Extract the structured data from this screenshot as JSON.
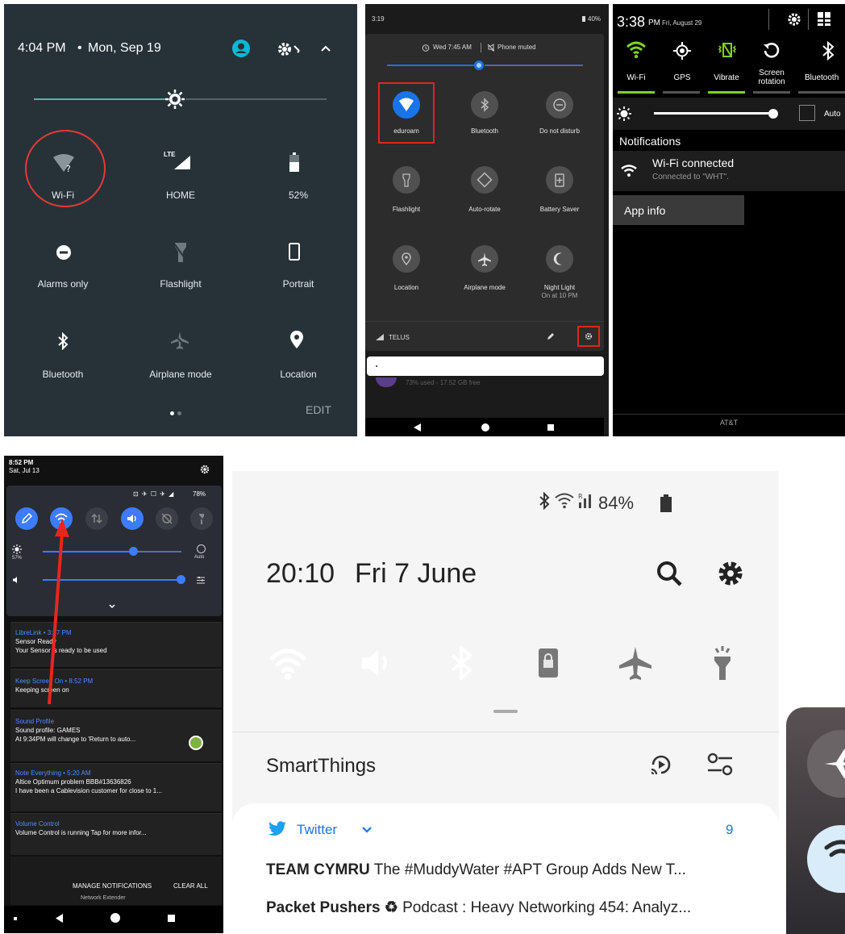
{
  "panel1": {
    "time": "4:04 PM",
    "sep": "•",
    "date": "Mon, Sep 19",
    "tiles": [
      {
        "label": "Wi-Fi",
        "icon": "wifi-unknown-icon"
      },
      {
        "label": "HOME",
        "icon": "lte-signal-icon"
      },
      {
        "label": "52%",
        "icon": "battery-icon"
      },
      {
        "label": "Alarms only",
        "icon": "alarms-only-icon"
      },
      {
        "label": "Flashlight",
        "icon": "flashlight-icon"
      },
      {
        "label": "Portrait",
        "icon": "portrait-icon"
      },
      {
        "label": "Bluetooth",
        "icon": "bluetooth-icon"
      },
      {
        "label": "Airplane mode",
        "icon": "airplane-icon"
      },
      {
        "label": "Location",
        "icon": "location-icon"
      }
    ],
    "lte_badge": "LTE",
    "edit": "EDIT",
    "accent": "#4db6ac",
    "annotation_color": "#e53935"
  },
  "panel2": {
    "clock": "3:19",
    "battery": "40%",
    "alarm": "Wed 7:45 AM",
    "muted": "Phone muted",
    "tiles": [
      {
        "label": "eduroam",
        "icon": "wifi-icon"
      },
      {
        "label": "Bluetooth",
        "icon": "bluetooth-icon"
      },
      {
        "label": "Do not disturb",
        "icon": "dnd-icon"
      },
      {
        "label": "Flashlight",
        "icon": "flashlight-icon"
      },
      {
        "label": "Auto-rotate",
        "icon": "auto-rotate-icon"
      },
      {
        "label": "Battery Saver",
        "icon": "battery-saver-icon"
      },
      {
        "label": "Location",
        "icon": "location-icon"
      },
      {
        "label": "Airplane mode",
        "icon": "airplane-icon"
      },
      {
        "label": "Night Light",
        "icon": "night-light-icon"
      }
    ],
    "night_sub": "On at 10 PM",
    "carrier": "TELUS",
    "storage": "73% used - 17.52 GB free",
    "accent": "#1a73e8"
  },
  "panel3": {
    "time": "3:38",
    "ampm": "PM",
    "date": "Fri, August 29",
    "toggles": [
      {
        "label": "Wi-Fi",
        "icon": "wifi-icon"
      },
      {
        "label": "GPS",
        "icon": "gps-icon"
      },
      {
        "label": "Vibrate",
        "icon": "vibrate-icon"
      },
      {
        "label": "Screen rotation",
        "icon": "rotation-icon"
      },
      {
        "label": "Bluetooth",
        "icon": "bluetooth-icon"
      }
    ],
    "auto": "Auto",
    "notifications": "Notifications",
    "notif_title": "Wi-Fi connected",
    "notif_sub": "Connected to \"WHT\".",
    "app_info": "App info",
    "carrier": "AT&T",
    "accent": "#7ed321"
  },
  "panel4": {
    "time": "8:52 PM",
    "date": "Sat, Jul 13",
    "battery": "78%",
    "bright_pct": "57%",
    "auto": "Auto",
    "brightness": 0.65,
    "volume": 1.0,
    "notifications": [
      {
        "app": "LibreLink • 3:17 PM",
        "title": "Sensor Ready",
        "body": "Your Sensor is ready to be used"
      },
      {
        "app": "Keep Screen On • 8:52 PM",
        "title": "Keeping screen on",
        "body": ""
      },
      {
        "app": "Sound Profile",
        "title": "Sound profile: GAMES",
        "body": "At 9:34PM will change to 'Return to auto..."
      },
      {
        "app": "Note Everything • 5:20 AM",
        "title": "Altice Optimum problem BBB#13636826",
        "body": "I have been a Cablevision customer for close to 1..."
      },
      {
        "app": "Volume Control",
        "title": "Volume Control is running Tap for more infor...",
        "body": ""
      }
    ],
    "manage": "MANAGE NOTIFICATIONS",
    "clear": "CLEAR ALL",
    "network": "Network Extender",
    "accent": "#3d7cff",
    "arrow_color": "#e8261d"
  },
  "panel5": {
    "battery": "84%",
    "time": "20:10",
    "date": "Fri 7 June",
    "smartthings": "SmartThings",
    "twitter": "Twitter",
    "count": "9",
    "rows": [
      {
        "bold": "TEAM CYMRU",
        "text": " The #MuddyWater #APT Group Adds New T..."
      },
      {
        "bold": "Packet Pushers ♻",
        "text": " Podcast : Heavy Networking 454: Analyz..."
      }
    ],
    "tiles": [
      {
        "name": "wifi",
        "icon": "wifi-icon",
        "on": true
      },
      {
        "name": "sound",
        "icon": "sound-icon",
        "on": true
      },
      {
        "name": "bluetooth",
        "icon": "bluetooth-icon",
        "on": true
      },
      {
        "name": "lock",
        "icon": "screen-lock-icon",
        "on": false
      },
      {
        "name": "airplane",
        "icon": "airplane-icon",
        "on": false
      },
      {
        "name": "flashlight",
        "icon": "flashlight-icon",
        "on": false
      }
    ],
    "accent": "#3f8ef4",
    "twitter_color": "#1da1f2"
  },
  "panel6": {
    "tiles": [
      {
        "icon": "airplane-icon"
      },
      {
        "icon": "wifi-icon"
      }
    ]
  }
}
